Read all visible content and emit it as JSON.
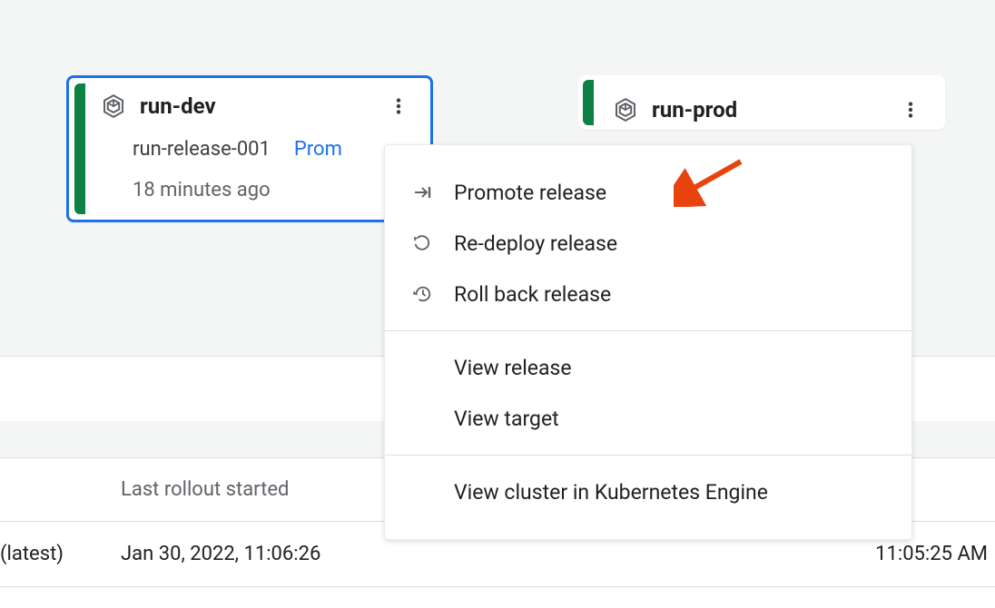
{
  "stages": {
    "dev": {
      "name": "run-dev",
      "release": "run-release-001",
      "promote_link": "Prom",
      "age": "18 minutes ago"
    },
    "prod": {
      "name": "run-prod"
    }
  },
  "menu": {
    "promote": "Promote release",
    "redeploy": "Re-deploy release",
    "rollback": "Roll back release",
    "view_release": "View release",
    "view_target": "View target",
    "view_cluster": "View cluster in Kubernetes Engine"
  },
  "table": {
    "header_last_rollout": "Last rollout started",
    "row_label": "(latest)",
    "row_started": "Jan 30, 2022, 11:06:26",
    "row_right": "11:05:25 AM"
  }
}
